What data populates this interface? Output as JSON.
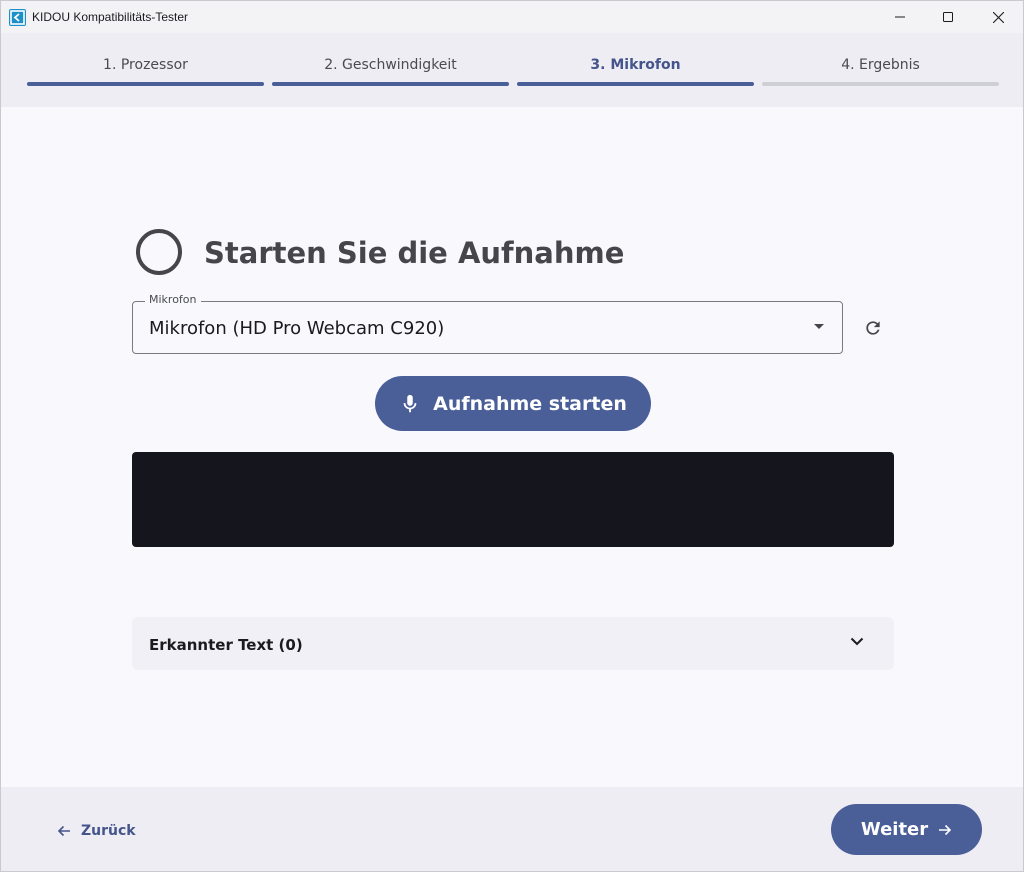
{
  "window": {
    "title": "KIDOU Kompatibilitäts-Tester",
    "icon": "kidou-logo-icon"
  },
  "stepper": {
    "steps": [
      {
        "label": "1. Prozessor",
        "state": "done"
      },
      {
        "label": "2. Geschwindigkeit",
        "state": "done"
      },
      {
        "label": "3. Mikrofon",
        "state": "active"
      },
      {
        "label": "4. Ergebnis",
        "state": "pending"
      }
    ]
  },
  "main": {
    "heading": "Starten Sie die Aufnahme",
    "status_icon": "empty-circle-icon",
    "microphone_field": {
      "legend": "Mikrofon",
      "value": "Mikrofon (HD Pro Webcam C920)"
    },
    "refresh_icon": "refresh-icon",
    "record_button": {
      "label": "Aufnahme starten",
      "icon": "microphone-icon"
    },
    "recognized_text": {
      "label": "Erkannter Text (0)"
    }
  },
  "footer": {
    "back_label": "Zurück",
    "next_label": "Weiter"
  },
  "colors": {
    "accent": "#4a5e98",
    "accent_text": "#45558c",
    "waveform_bg": "#15161d"
  }
}
